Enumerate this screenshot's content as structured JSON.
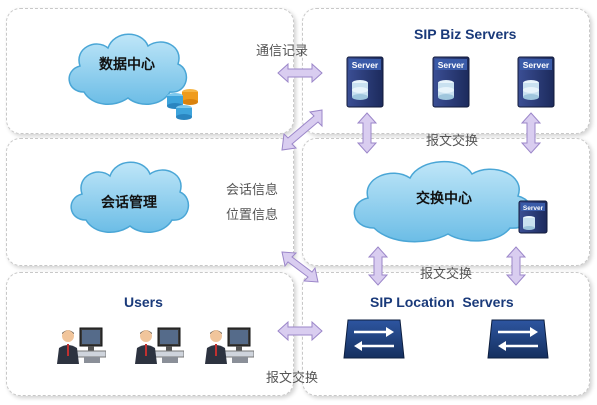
{
  "panels": {
    "data_center": {
      "cloud_label": "数据中心"
    },
    "biz_servers": {
      "title": "SIP Biz Servers",
      "servers": [
        {
          "label": "Server"
        },
        {
          "label": "Server"
        },
        {
          "label": "Server"
        }
      ]
    },
    "session_mgmt": {
      "cloud_label": "会话管理",
      "info_labels": [
        "会话信息",
        "位置信息"
      ]
    },
    "switch_center": {
      "cloud_label": "交换中心",
      "server_label": "Server"
    },
    "users": {
      "title": "Users",
      "user_count": 3
    },
    "location_servers": {
      "title": "SIP Location  Servers",
      "device_count": 2
    }
  },
  "connector_labels": {
    "comm_records": "通信记录",
    "msg_exchange_1": "报文交换",
    "msg_exchange_2": "报文交换",
    "msg_exchange_3": "报文交换"
  },
  "colors": {
    "cloud_fill": "#8fd0ee",
    "cloud_stroke": "#4aa6d6",
    "arrow_fill": "#d9cdf0",
    "arrow_stroke": "#9b86c9",
    "server_body": "#2e3f7e",
    "location_device": "#1f3d7a",
    "title_color": "#1a3a7a"
  },
  "icons": [
    "database-icon",
    "server-icon",
    "user-workstation-icon",
    "location-router-icon"
  ]
}
